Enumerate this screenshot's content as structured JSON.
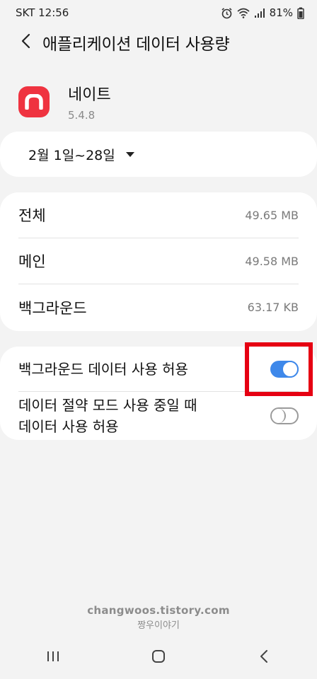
{
  "status_bar": {
    "carrier_time": "SKT 12:56",
    "battery": "81%",
    "icons": [
      "alarm-icon",
      "wifi-icon",
      "signal-icon",
      "battery-icon"
    ]
  },
  "app_bar": {
    "title": "애플리케이션 데이터 사용량"
  },
  "app": {
    "name": "네이트",
    "version": "5.4.8",
    "brand_color": "#ef3340"
  },
  "date_range": {
    "label": "2월 1일~28일"
  },
  "usage": [
    {
      "label": "전체",
      "value": "49.65 MB"
    },
    {
      "label": "메인",
      "value": "49.58 MB"
    },
    {
      "label": "백그라운드",
      "value": "63.17 KB"
    }
  ],
  "toggles": [
    {
      "label": "백그라운드 데이터 사용 허용",
      "on": true
    },
    {
      "label_line1": "데이터 절약 모드 사용 중일 때",
      "label_line2": "데이터 사용 허용",
      "on": false
    }
  ],
  "accent_color": "#3e88ea",
  "highlight_color": "#e60012",
  "watermark": {
    "line1": "changwoos.tistory.com",
    "line2": "짱우이야기"
  }
}
